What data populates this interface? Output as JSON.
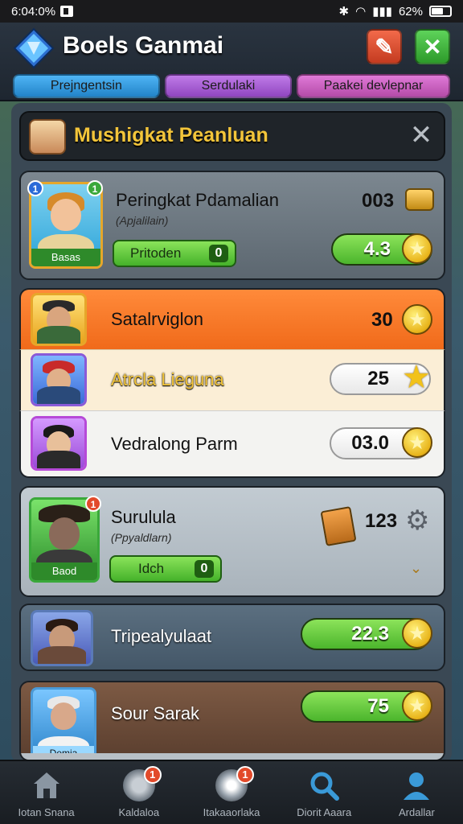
{
  "status_bar": {
    "time": "6:04:0%",
    "battery": "62%",
    "battery_level": 0.62
  },
  "header": {
    "title": "Boels Ganmai"
  },
  "tabs": [
    {
      "label": "Prejngentsin"
    },
    {
      "label": "Serdulaki"
    },
    {
      "label": "Paakei devlepnar"
    }
  ],
  "panel": {
    "title": "Mushigkat Peanluan"
  },
  "players": [
    {
      "name": "Peringkat Pdamalian",
      "subtitle": "(Apjalilain)",
      "badge": "Basas",
      "button": "Pritoden",
      "button_count": "0",
      "score": "003",
      "points": "4.3",
      "rank_left": "1",
      "rank_right": "1"
    },
    {
      "name": "Satalrviglon",
      "score": "30"
    },
    {
      "name": "Atrcla Lieguna",
      "score": "25"
    },
    {
      "name": "Vedralong Parm",
      "score": "03.0"
    },
    {
      "name": "Surulula",
      "subtitle": "(Ppyaldlarn)",
      "badge": "Baod",
      "button": "Idch",
      "button_count": "0",
      "score": "123",
      "rank_right": "1"
    },
    {
      "name": "Tripealyulaat",
      "score": "22.3"
    },
    {
      "name": "Sour Sarak",
      "score": "75",
      "badge": "Demia"
    }
  ],
  "nav": [
    {
      "label": "Iotan Snana",
      "icon": "home-icon"
    },
    {
      "label": "Kaldaloa",
      "icon": "controller-icon",
      "dot": "1"
    },
    {
      "label": "Itakaaorlaka",
      "icon": "disc-icon",
      "dot": "1"
    },
    {
      "label": "Diorit Aaara",
      "icon": "search-icon"
    },
    {
      "label": "Ardallar",
      "icon": "profile-icon"
    }
  ],
  "colors": {
    "accent_green": "#4bb52c",
    "accent_orange": "#f06a1a",
    "gold": "#f3c53a"
  }
}
